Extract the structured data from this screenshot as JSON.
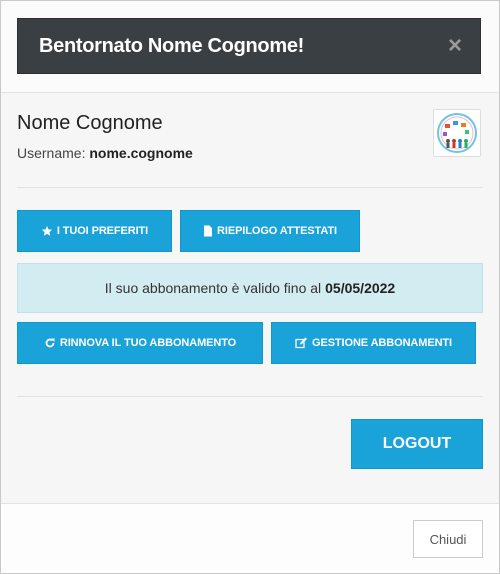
{
  "modal": {
    "header": {
      "title": "Bentornato Nome Cognome!",
      "close_label": "×"
    },
    "user": {
      "full_name": "Nome Cognome",
      "username_label": "Username:",
      "username": "nome.cognome"
    },
    "actions_top": [
      {
        "label": "I TUOI PREFERITI",
        "icon": "star-icon"
      },
      {
        "label": "RIEPILOGO ATTESTATI",
        "icon": "file-icon"
      }
    ],
    "subscription": {
      "text": "Il suo abbonamento è valido fino al",
      "date": "05/05/2022"
    },
    "actions_bottom": [
      {
        "label": "RINNOVA IL TUO ABBONAMENTO",
        "icon": "refresh-icon"
      },
      {
        "label": "GESTIONE ABBONAMENTI",
        "icon": "edit-icon"
      }
    ],
    "logout_label": "LOGOUT",
    "footer": {
      "close_label": "Chiudi"
    },
    "colors": {
      "header_bg": "#3a3f44",
      "primary": "#1aa3d8",
      "info_bg": "#d3ecf2"
    }
  }
}
